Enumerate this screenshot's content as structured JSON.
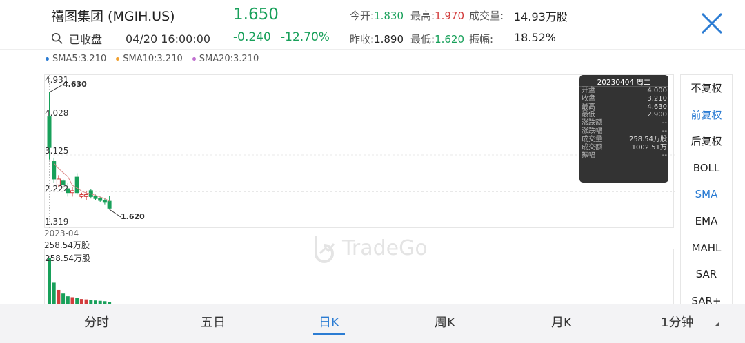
{
  "header": {
    "title": "禧图集团 (MGIH.US)",
    "status": "已收盘",
    "datetime": "04/20  16:00:00",
    "price": "1.650",
    "change": "-0.240",
    "change_pct": "-12.70%",
    "open_label": "今开:",
    "open_value": "1.830",
    "high_label": "最高:",
    "high_value": "1.970",
    "volume_label": "成交量:",
    "volume_value": "14.93万股",
    "prevclose_label": "昨收:",
    "prevclose_value": "1.890",
    "low_label": "最低:",
    "low_value": "1.620",
    "amplitude_label": "振幅:",
    "amplitude_value": "18.52%"
  },
  "sma_legend": [
    {
      "label": "SMA5:3.210",
      "color": "#2b7cd3"
    },
    {
      "label": "SMA10:3.210",
      "color": "#f0a030"
    },
    {
      "label": "SMA20:3.210",
      "color": "#c070d0"
    }
  ],
  "price_axis": [
    "4.931",
    "4.028",
    "3.125",
    "2.222",
    "1.319"
  ],
  "date_axis": "2023-04",
  "marker_high": "4.630",
  "marker_low": "1.620",
  "volume": {
    "top_label": "258.54万股",
    "inner_label": "258.54万股"
  },
  "tooltip": {
    "title": "20230404 周二",
    "rows": [
      {
        "k": "开盘",
        "v": "4.000"
      },
      {
        "k": "收盘",
        "v": "3.210"
      },
      {
        "k": "最高",
        "v": "4.630"
      },
      {
        "k": "最低",
        "v": "2.900"
      },
      {
        "k": "涨跌额",
        "v": "--"
      },
      {
        "k": "涨跌幅",
        "v": "--"
      },
      {
        "k": "成交量",
        "v": "258.54万股"
      },
      {
        "k": "成交额",
        "v": "1002.51万"
      },
      {
        "k": "振幅",
        "v": "--"
      }
    ]
  },
  "side_menu": [
    "不复权",
    "前复权",
    "后复权",
    "BOLL",
    "SMA",
    "EMA",
    "MAHL",
    "SAR",
    "SAR+"
  ],
  "watermark": "TradeGo",
  "tabs": [
    "分时",
    "五日",
    "日K",
    "周K",
    "月K",
    "1分钟"
  ],
  "colors": {
    "up": "#d23c3c",
    "down": "#18a05a",
    "accent": "#2b7cd3"
  },
  "chart_data": {
    "type": "candlestick",
    "ylim": [
      1.319,
      4.931
    ],
    "candles": [
      {
        "o": 4.0,
        "c": 3.21,
        "h": 4.63,
        "l": 2.9
      },
      {
        "o": 2.85,
        "c": 2.4,
        "h": 2.95,
        "l": 2.3
      },
      {
        "o": 2.25,
        "c": 2.4,
        "h": 2.5,
        "l": 2.2
      },
      {
        "o": 2.35,
        "c": 2.25,
        "h": 2.4,
        "l": 2.15
      },
      {
        "o": 2.15,
        "c": 2.05,
        "h": 2.3,
        "l": 1.95
      },
      {
        "o": 2.05,
        "c": 2.1,
        "h": 2.2,
        "l": 1.95
      },
      {
        "o": 2.45,
        "c": 2.05,
        "h": 2.55,
        "l": 2.0
      },
      {
        "o": 1.95,
        "c": 2.0,
        "h": 2.05,
        "l": 1.9
      },
      {
        "o": 1.95,
        "c": 2.0,
        "h": 2.1,
        "l": 1.85
      },
      {
        "o": 2.1,
        "c": 1.95,
        "h": 2.15,
        "l": 1.9
      },
      {
        "o": 1.95,
        "c": 1.9,
        "h": 2.0,
        "l": 1.85
      },
      {
        "o": 1.9,
        "c": 1.85,
        "h": 1.95,
        "l": 1.8
      },
      {
        "o": 1.85,
        "c": 1.8,
        "h": 1.9,
        "l": 1.75
      },
      {
        "o": 1.83,
        "c": 1.65,
        "h": 1.97,
        "l": 1.62
      }
    ],
    "volumes": [
      258.54,
      120,
      80,
      60,
      45,
      40,
      35,
      30,
      28,
      25,
      22,
      20,
      18,
      15
    ]
  }
}
